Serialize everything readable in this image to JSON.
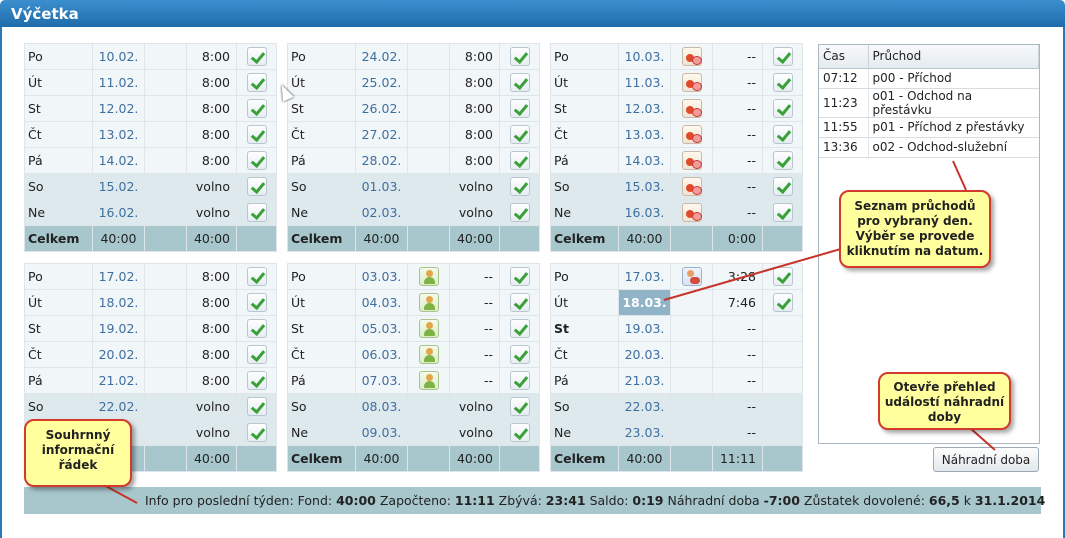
{
  "window": {
    "title": "Výčetka"
  },
  "weeks": [
    {
      "id": "w1",
      "rows": [
        {
          "day": "Po",
          "date": "10.02.",
          "hours": "8:00",
          "icon": "",
          "check": true,
          "type": "wd"
        },
        {
          "day": "Út",
          "date": "11.02.",
          "hours": "8:00",
          "icon": "",
          "check": true,
          "type": "wd"
        },
        {
          "day": "St",
          "date": "12.02.",
          "hours": "8:00",
          "icon": "",
          "check": true,
          "type": "wd"
        },
        {
          "day": "Čt",
          "date": "13.02.",
          "hours": "8:00",
          "icon": "",
          "check": true,
          "type": "wd"
        },
        {
          "day": "Pá",
          "date": "14.02.",
          "hours": "8:00",
          "icon": "",
          "check": true,
          "type": "wd"
        },
        {
          "day": "So",
          "date": "15.02.",
          "hours": "volno",
          "icon": "",
          "check": true,
          "type": "we"
        },
        {
          "day": "Ne",
          "date": "16.02.",
          "hours": "volno",
          "icon": "",
          "check": true,
          "type": "we"
        }
      ],
      "total": {
        "label": "Celkem",
        "fund": "40:00",
        "worked": "40:00"
      }
    },
    {
      "id": "w2",
      "rows": [
        {
          "day": "Po",
          "date": "24.02.",
          "hours": "8:00",
          "icon": "",
          "check": true,
          "type": "wd"
        },
        {
          "day": "Út",
          "date": "25.02.",
          "hours": "8:00",
          "icon": "",
          "check": true,
          "type": "wd"
        },
        {
          "day": "St",
          "date": "26.02.",
          "hours": "8:00",
          "icon": "",
          "check": true,
          "type": "wd"
        },
        {
          "day": "Čt",
          "date": "27.02.",
          "hours": "8:00",
          "icon": "",
          "check": true,
          "type": "wd"
        },
        {
          "day": "Pá",
          "date": "28.02.",
          "hours": "8:00",
          "icon": "",
          "check": true,
          "type": "wd"
        },
        {
          "day": "So",
          "date": "01.03.",
          "hours": "volno",
          "icon": "",
          "check": true,
          "type": "we"
        },
        {
          "day": "Ne",
          "date": "02.03.",
          "hours": "volno",
          "icon": "",
          "check": true,
          "type": "we"
        }
      ],
      "total": {
        "label": "Celkem",
        "fund": "40:00",
        "worked": "40:00"
      }
    },
    {
      "id": "w3",
      "rows": [
        {
          "day": "Po",
          "date": "10.03.",
          "hours": "--",
          "icon": "pills-icon",
          "check": true,
          "type": "wd"
        },
        {
          "day": "Út",
          "date": "11.03.",
          "hours": "--",
          "icon": "pills-icon",
          "check": true,
          "type": "wd"
        },
        {
          "day": "St",
          "date": "12.03.",
          "hours": "--",
          "icon": "pills-icon",
          "check": true,
          "type": "wd"
        },
        {
          "day": "Čt",
          "date": "13.03.",
          "hours": "--",
          "icon": "pills-icon",
          "check": true,
          "type": "wd"
        },
        {
          "day": "Pá",
          "date": "14.03.",
          "hours": "--",
          "icon": "pills-icon",
          "check": true,
          "type": "wd"
        },
        {
          "day": "So",
          "date": "15.03.",
          "hours": "--",
          "icon": "pills-icon",
          "check": true,
          "type": "we"
        },
        {
          "day": "Ne",
          "date": "16.03.",
          "hours": "--",
          "icon": "pills-icon",
          "check": true,
          "type": "we"
        }
      ],
      "total": {
        "label": "Celkem",
        "fund": "40:00",
        "worked": "0:00"
      }
    },
    {
      "id": "w4",
      "rows": [
        {
          "day": "Po",
          "date": "17.02.",
          "hours": "8:00",
          "icon": "",
          "check": true,
          "type": "wd"
        },
        {
          "day": "Út",
          "date": "18.02.",
          "hours": "8:00",
          "icon": "",
          "check": true,
          "type": "wd"
        },
        {
          "day": "St",
          "date": "19.02.",
          "hours": "8:00",
          "icon": "",
          "check": true,
          "type": "wd"
        },
        {
          "day": "Čt",
          "date": "20.02.",
          "hours": "8:00",
          "icon": "",
          "check": true,
          "type": "wd"
        },
        {
          "day": "Pá",
          "date": "21.02.",
          "hours": "8:00",
          "icon": "",
          "check": true,
          "type": "wd"
        },
        {
          "day": "So",
          "date": "22.02.",
          "hours": "volno",
          "icon": "",
          "check": true,
          "type": "we"
        },
        {
          "day": "",
          "date": "",
          "hours": "volno",
          "icon": "",
          "check": true,
          "type": "we"
        }
      ],
      "total": {
        "label": "",
        "fund": "",
        "worked": "40:00"
      }
    },
    {
      "id": "w5",
      "rows": [
        {
          "day": "Po",
          "date": "03.03.",
          "hours": "--",
          "icon": "person-icon",
          "check": true,
          "type": "wd"
        },
        {
          "day": "Út",
          "date": "04.03.",
          "hours": "--",
          "icon": "person-icon",
          "check": true,
          "type": "wd"
        },
        {
          "day": "St",
          "date": "05.03.",
          "hours": "--",
          "icon": "person-icon",
          "check": true,
          "type": "wd"
        },
        {
          "day": "Čt",
          "date": "06.03.",
          "hours": "--",
          "icon": "person-icon",
          "check": true,
          "type": "wd"
        },
        {
          "day": "Pá",
          "date": "07.03.",
          "hours": "--",
          "icon": "person-icon",
          "check": true,
          "type": "wd"
        },
        {
          "day": "So",
          "date": "08.03.",
          "hours": "volno",
          "icon": "",
          "check": true,
          "type": "we"
        },
        {
          "day": "Ne",
          "date": "09.03.",
          "hours": "volno",
          "icon": "",
          "check": true,
          "type": "we"
        }
      ],
      "total": {
        "label": "Celkem",
        "fund": "40:00",
        "worked": "40:00"
      }
    },
    {
      "id": "w6",
      "rows": [
        {
          "day": "Po",
          "date": "17.03.",
          "hours": "3:28",
          "icon": "doctor-icon",
          "check": true,
          "type": "wd"
        },
        {
          "day": "Út",
          "date": "18.03.",
          "hours": "7:46",
          "icon": "",
          "check": true,
          "type": "wd",
          "selected": true
        },
        {
          "day": "St",
          "date": "19.03.",
          "hours": "--",
          "icon": "",
          "check": false,
          "type": "wd",
          "bold": true
        },
        {
          "day": "Čt",
          "date": "20.03.",
          "hours": "--",
          "icon": "",
          "check": false,
          "type": "wd"
        },
        {
          "day": "Pá",
          "date": "21.03.",
          "hours": "--",
          "icon": "",
          "check": false,
          "type": "wd"
        },
        {
          "day": "So",
          "date": "22.03.",
          "hours": "--",
          "icon": "",
          "check": false,
          "type": "we"
        },
        {
          "day": "Ne",
          "date": "23.03.",
          "hours": "--",
          "icon": "",
          "check": false,
          "type": "we"
        }
      ],
      "total": {
        "label": "Celkem",
        "fund": "40:00",
        "worked": "11:11"
      }
    }
  ],
  "passes": {
    "headers": {
      "time": "Čas",
      "pass": "Průchod"
    },
    "rows": [
      {
        "time": "07:12",
        "pass": "p00 - Příchod"
      },
      {
        "time": "11:23",
        "pass": "o01 - Odchod na přestávku"
      },
      {
        "time": "11:55",
        "pass": "p01 - Příchod z přestávky"
      },
      {
        "time": "13:36",
        "pass": "o02 - Odchod-služební"
      }
    ]
  },
  "buttons": {
    "replacement": "Náhradní doba"
  },
  "info": {
    "prefix": "Info pro poslední týden: Fond: ",
    "fund": "40:00",
    "counted_label": " Započteno: ",
    "counted": "11:11",
    "remaining_label": " Zbývá: ",
    "remaining": "23:41",
    "balance_label": " Saldo: ",
    "balance": "0:19",
    "replacement_label": " Náhradní doba ",
    "replacement": "-7:00",
    "vacation_label": " Zůstatek dovolené: ",
    "vacation": "66,5",
    "vacation_to": " k ",
    "vacation_date": "31.1.2014"
  },
  "callouts": {
    "passes": [
      "Seznam průchodů",
      "pro vybraný den.",
      "Výběr se provede",
      "kliknutím na datum."
    ],
    "replacement": [
      "Otevře přehled",
      "událostí náhradní",
      "doby"
    ],
    "summary": [
      "Souhrnný",
      "informační",
      "řádek"
    ]
  }
}
